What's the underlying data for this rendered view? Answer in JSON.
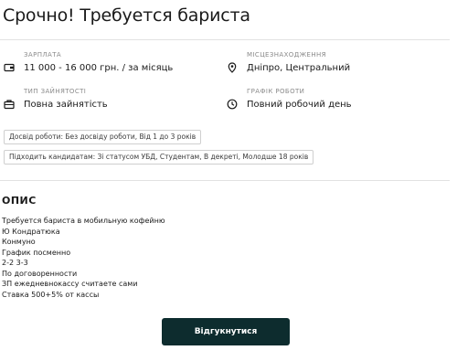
{
  "job": {
    "title": "Срочно! Требуется бариста"
  },
  "details": {
    "salary": {
      "label": "ЗАРПЛАТА",
      "value": "11 000 - 16 000 грн. / за місяць",
      "icon": "money-icon"
    },
    "location": {
      "label": "МІСЦЕЗНАХОДЖЕННЯ",
      "value": "Дніпро, Центральний",
      "icon": "location-pin-icon"
    },
    "employment": {
      "label": "ТИП ЗАЙНЯТОСТІ",
      "value": "Повна зайнятість",
      "icon": "briefcase-icon"
    },
    "schedule": {
      "label": "ГРАФІК РОБОТИ",
      "value": "Повний робочий день",
      "icon": "clock-icon"
    }
  },
  "tags": [
    "Досвід роботи: Без досвіду роботи, Від 1 до 3 років",
    "Підходить кандидатам: Зі статусом УБД, Студентам, В декреті, Молодше 18 років"
  ],
  "description": {
    "heading": "ОПИС",
    "lines": [
      "Требуется бариста в мобильную кофейню",
      "Ю Кондратюка",
      "Конмуно",
      "График посменно",
      "2-2 3-3",
      "По договоренности",
      "ЗП ежедневнокассу считаете сами",
      "Ставка 500+5% от кассы"
    ]
  },
  "actions": {
    "apply_label": "Відгукнутися"
  },
  "colors": {
    "button_bg": "#0d2c2e",
    "divider": "#e2e2e2",
    "label": "#8a8a8a"
  }
}
